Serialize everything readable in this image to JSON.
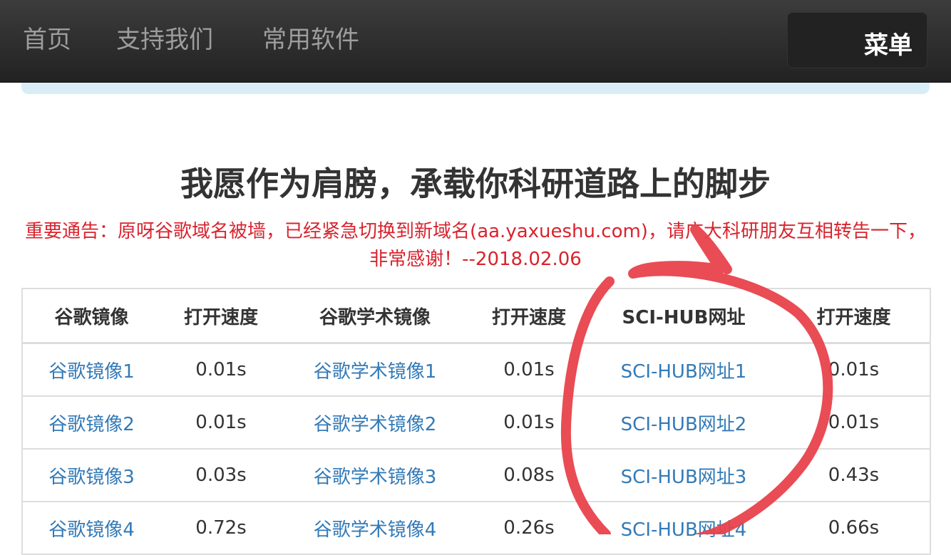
{
  "nav": {
    "items": [
      {
        "label": "首页"
      },
      {
        "label": "支持我们"
      },
      {
        "label": "常用软件"
      }
    ],
    "menu_label": "菜单"
  },
  "headline": "我愿作为肩膀，承载你科研道路上的脚步",
  "notice": "重要通告：原呀谷歌域名被墙，已经紧急切换到新域名(aa.yaxueshu.com)，请广大科研朋友互相转告一下，非常感谢！--2018.02.06",
  "table": {
    "headers": [
      "谷歌镜像",
      "打开速度",
      "谷歌学术镜像",
      "打开速度",
      "SCI-HUB网址",
      "打开速度"
    ],
    "rows": [
      {
        "google": "谷歌镜像1",
        "google_speed": "0.01s",
        "scholar": "谷歌学术镜像1",
        "scholar_speed": "0.01s",
        "scihub": "SCI-HUB网址1",
        "scihub_speed": "0.01s"
      },
      {
        "google": "谷歌镜像2",
        "google_speed": "0.01s",
        "scholar": "谷歌学术镜像2",
        "scholar_speed": "0.01s",
        "scihub": "SCI-HUB网址2",
        "scihub_speed": "0.01s"
      },
      {
        "google": "谷歌镜像3",
        "google_speed": "0.03s",
        "scholar": "谷歌学术镜像3",
        "scholar_speed": "0.08s",
        "scihub": "SCI-HUB网址3",
        "scihub_speed": "0.43s"
      },
      {
        "google": "谷歌镜像4",
        "google_speed": "0.72s",
        "scholar": "谷歌学术镜像4",
        "scholar_speed": "0.26s",
        "scihub": "SCI-HUB网址4",
        "scihub_speed": "0.66s"
      }
    ]
  },
  "colors": {
    "link": "#337ab7",
    "notice": "#d9232d",
    "annotation": "#e8424b"
  }
}
